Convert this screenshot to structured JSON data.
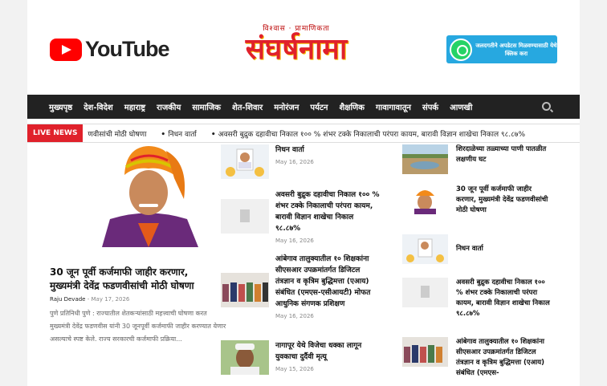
{
  "header": {
    "youtube_word": "YouTube",
    "logo_top": "विश्वास · प्रामाणिकता",
    "logo_main": "संघर्षनामा",
    "whatsapp_text": "जलदगतीने अपडेटस मिळवण्यासाठी येथे क्लिक करा"
  },
  "nav": {
    "items": [
      "मुख्यपृष्ठ",
      "देश-विदेश",
      "महाराष्ट्र",
      "राजकीय",
      "सामाजिक",
      "शेत-शिवार",
      "मनोरंजन",
      "पर्यटन",
      "शैक्षणिक",
      "गावागावातून",
      "संपर्क",
      "आणखी"
    ]
  },
  "ticker": {
    "label": "LIVE NEWS",
    "items": [
      "णवीसांची मोठी घोषणा",
      "निधन वार्ता",
      "अवसरी बुद्रुक दहावीचा निकाल १०० % शंभर टक्के निकालाची परंपरा कायम, बारावी विज्ञान शाखेचा निकाल ९८.८७%"
    ]
  },
  "featured": {
    "title": "30 जून पूर्वी कर्जमाफी जाहीर करणार, मुख्यमंत्री देवेंद्र फडणवीसांची मोठी घोषणा",
    "author": "Raju Devade",
    "date": "May 17, 2026",
    "excerpt": "पुणे प्रतिनिधी पुणे : राज्यातील शेतकऱ्यांसाठी महत्त्वाची घोषणा करत मुख्यमंत्री देवेंद्र फडणवीस यांनी 30 जूनपूर्वी कर्जमाफी जाहीर करण्यात येणार असल्याचे स्पष्ट केले. राज्य सरकारची कर्जमाफी प्रक्रिया..."
  },
  "middle": [
    {
      "title": "निधन वार्ता",
      "date": "May 16, 2026"
    },
    {
      "title": "अवसरी बुद्रुक दहावीचा निकाल १०० % शंभर टक्के निकालाची परंपरा कायम, बारावी विज्ञान शाखेचा निकाल ९८.८७%",
      "date": "May 16, 2026"
    },
    {
      "title": "आंबेगाव तालुक्यातील १० शिक्षकांना सीएसआर उपक्रमांतर्गत डिजिटल तंत्रज्ञान व कृत्रिम बुद्धिमत्ता (एआय) संबंधित (एमएस-एसीआयटी) मोफत आधुनिक संगणक प्रशिक्षण",
      "date": "May 16, 2026"
    },
    {
      "title": "नागापूर येथे विजेचा धक्का लागून युवकाचा दुर्दैवी मृत्यू",
      "date": "May 15, 2026"
    }
  ],
  "right": [
    {
      "title": "शिरदाळेच्या तळ्याच्या पाणी पातळीत लक्षणीय घट"
    },
    {
      "title": "30 जून पूर्वी कर्जमाफी जाहीर करणार, मुख्यमंत्री देवेंद्र फडणवीसांची मोठी घोषणा"
    },
    {
      "title": "निधन वार्ता"
    },
    {
      "title": "अवसरी बुद्रुक दहावीचा निकाल १०० % शंभर टक्के निकालाची परंपरा कायम, बारावी विज्ञान शाखेचा निकाल ९८.८७%"
    },
    {
      "title": "आंबेगाव तालुक्यातील १० शिक्षकांना सीएसआर उपक्रमांतर्गत डिजिटल तंत्रज्ञान व कृत्रिम बुद्धिमत्ता (एआय) संबंधित (एमएस-"
    }
  ]
}
